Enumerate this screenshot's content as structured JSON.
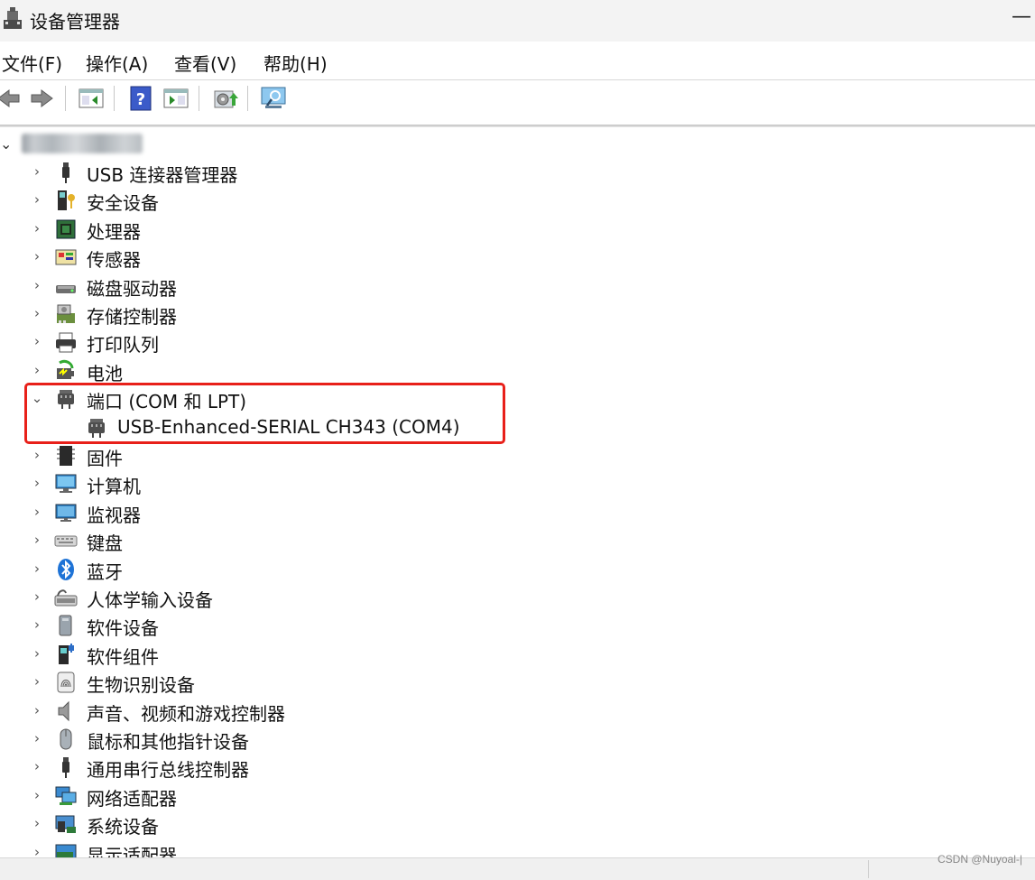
{
  "window": {
    "title": "设备管理器"
  },
  "menu": [
    "文件(F)",
    "操作(A)",
    "查看(V)",
    "帮助(H)"
  ],
  "toolbar": {
    "buttons": [
      "back-icon",
      "forward-icon",
      "show-hide-console-tree-icon",
      "help-icon",
      "action-pane-icon",
      "update-driver-icon",
      "scan-hardware-icon"
    ]
  },
  "tree": {
    "root_label": "",
    "categories": [
      {
        "label": "USB 连接器管理器",
        "icon": "usb-connector-icon",
        "expanded": false
      },
      {
        "label": "安全设备",
        "icon": "security-device-icon",
        "expanded": false
      },
      {
        "label": "处理器",
        "icon": "processor-icon",
        "expanded": false
      },
      {
        "label": "传感器",
        "icon": "sensor-icon",
        "expanded": false
      },
      {
        "label": "磁盘驱动器",
        "icon": "disk-drive-icon",
        "expanded": false
      },
      {
        "label": "存储控制器",
        "icon": "storage-controller-icon",
        "expanded": false
      },
      {
        "label": "打印队列",
        "icon": "printer-icon",
        "expanded": false
      },
      {
        "label": "电池",
        "icon": "battery-icon",
        "expanded": false
      },
      {
        "label": "端口 (COM 和 LPT)",
        "icon": "port-icon",
        "expanded": true,
        "children": [
          {
            "label": "USB-Enhanced-SERIAL CH343 (COM4)",
            "icon": "port-icon"
          }
        ]
      },
      {
        "label": "固件",
        "icon": "firmware-icon",
        "expanded": false
      },
      {
        "label": "计算机",
        "icon": "computer-icon",
        "expanded": false
      },
      {
        "label": "监视器",
        "icon": "monitor-icon",
        "expanded": false
      },
      {
        "label": "键盘",
        "icon": "keyboard-icon",
        "expanded": false
      },
      {
        "label": "蓝牙",
        "icon": "bluetooth-icon",
        "expanded": false
      },
      {
        "label": "人体学输入设备",
        "icon": "hid-icon",
        "expanded": false
      },
      {
        "label": "软件设备",
        "icon": "software-device-icon",
        "expanded": false
      },
      {
        "label": "软件组件",
        "icon": "software-component-icon",
        "expanded": false
      },
      {
        "label": "生物识别设备",
        "icon": "biometric-icon",
        "expanded": false
      },
      {
        "label": "声音、视频和游戏控制器",
        "icon": "sound-icon",
        "expanded": false
      },
      {
        "label": "鼠标和其他指针设备",
        "icon": "mouse-icon",
        "expanded": false
      },
      {
        "label": "通用串行总线控制器",
        "icon": "usb-controller-icon",
        "expanded": false
      },
      {
        "label": "网络适配器",
        "icon": "network-adapter-icon",
        "expanded": false
      },
      {
        "label": "系统设备",
        "icon": "system-device-icon",
        "expanded": false
      },
      {
        "label": "显示适配器",
        "icon": "display-adapter-icon",
        "expanded": false
      }
    ]
  },
  "watermark": "CSDN @Nuyoal-|",
  "colors": {
    "highlight": "#e8201a"
  }
}
